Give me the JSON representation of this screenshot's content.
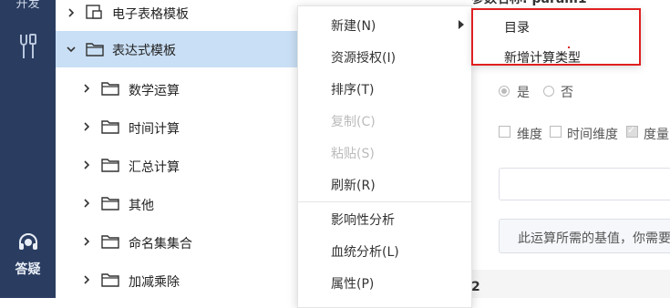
{
  "rail": {
    "top_label": "开发",
    "help_label": "答疑"
  },
  "tree": {
    "items": [
      {
        "label": "电子表格模板",
        "expanded": false,
        "selected": false,
        "level": 1
      },
      {
        "label": "表达式模板",
        "expanded": true,
        "selected": true,
        "level": 1
      },
      {
        "label": "数学运算",
        "expanded": false,
        "selected": false,
        "level": 2
      },
      {
        "label": "时间计算",
        "expanded": false,
        "selected": false,
        "level": 2
      },
      {
        "label": "汇总计算",
        "expanded": false,
        "selected": false,
        "level": 2
      },
      {
        "label": "其他",
        "expanded": false,
        "selected": false,
        "level": 2
      },
      {
        "label": "命名集集合",
        "expanded": false,
        "selected": false,
        "level": 2
      },
      {
        "label": "加减乘除",
        "expanded": false,
        "selected": false,
        "level": 2
      }
    ]
  },
  "context_menu": {
    "items": [
      {
        "label": "新建(N)",
        "disabled": false,
        "has_submenu": true
      },
      {
        "label": "资源授权(I)",
        "disabled": false
      },
      {
        "label": "排序(T)",
        "disabled": false
      },
      {
        "label": "复制(C)",
        "disabled": true
      },
      {
        "label": "粘贴(S)",
        "disabled": true
      },
      {
        "label": "刷新(R)",
        "disabled": false
      },
      {
        "label": "影响性分析",
        "disabled": false
      },
      {
        "label": "血统分析(L)",
        "disabled": false
      },
      {
        "label": "属性(P)",
        "disabled": false
      }
    ]
  },
  "submenu": {
    "items": [
      {
        "label": "目录"
      },
      {
        "label": "新增计算类型"
      }
    ],
    "highlight_color": "#e02020"
  },
  "form": {
    "partial_title": "参数名称: param1",
    "radio_yes": "是",
    "radio_no": "否",
    "check_dimension": "维度",
    "check_time_dimension": "时间维度",
    "check_measure": "度量",
    "hint_text": "此运算所需的基值，你需要",
    "bottom_fragment": "2"
  },
  "colors": {
    "rail_bg": "#2a3d61",
    "selected_bg": "#c9dff5",
    "accent_red": "#e02020"
  }
}
